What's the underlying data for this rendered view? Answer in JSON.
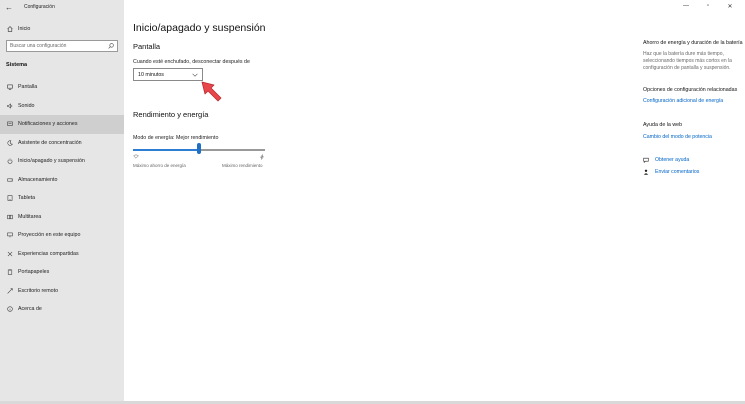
{
  "window": {
    "title": "Configuración"
  },
  "title_controls": {
    "back": "←",
    "minimize": "—",
    "maximize": "▫",
    "close": "✕"
  },
  "sidebar": {
    "home_label": "Inicio",
    "search_placeholder": "Buscar una configuración",
    "section": "Sistema",
    "items": [
      {
        "label": "Pantalla",
        "icon": "monitor-icon",
        "active": false
      },
      {
        "label": "Sonido",
        "icon": "speaker-icon",
        "active": false
      },
      {
        "label": "Notificaciones y acciones",
        "icon": "notifications-icon",
        "active": true
      },
      {
        "label": "Asistente de concentración",
        "icon": "moon-icon",
        "active": false
      },
      {
        "label": "Inicio/apagado y suspensión",
        "icon": "power-icon",
        "active": false
      },
      {
        "label": "Almacenamiento",
        "icon": "storage-icon",
        "active": false
      },
      {
        "label": "Tableta",
        "icon": "tablet-icon",
        "active": false
      },
      {
        "label": "Multitarea",
        "icon": "multitask-icon",
        "active": false
      },
      {
        "label": "Proyección en este equipo",
        "icon": "projection-icon",
        "active": false
      },
      {
        "label": "Experiencias compartidas",
        "icon": "shared-icon",
        "active": false
      },
      {
        "label": "Portapapeles",
        "icon": "clipboard-icon",
        "active": false
      },
      {
        "label": "Escritorio remoto",
        "icon": "remote-desktop-icon",
        "active": false
      },
      {
        "label": "Acerca de",
        "icon": "info-icon",
        "active": false
      }
    ]
  },
  "main": {
    "title": "Inicio/apagado y suspensión",
    "screen_section": "Pantalla",
    "screen_field_label": "Cuando esté enchufado, desconectar después de",
    "screen_dropdown_value": "10 minutos",
    "performance_section": "Rendimiento y energía",
    "power_mode_label": "Modo de energía: Mejor rendimiento",
    "slider_level": 0.5,
    "slider_min_label": "Máximo ahorro de energía",
    "slider_max_label": "Máximo rendimiento"
  },
  "right_pane": {
    "battery_heading": "Ahorro de energía y duración de la batería",
    "battery_text": "Haz que la batería dure más tiempo, seleccionando tiempos más cortos en la configuración de pantalla y suspensión.",
    "related_heading": "Opciones de configuración relacionadas",
    "related_link": "Configuración adicional de energía",
    "web_help_heading": "Ayuda de la web",
    "web_help_link": "Cambio del modo de potencia",
    "get_help": "Obtener ayuda",
    "feedback": "Enviar comentarios"
  },
  "colors": {
    "accent": "#0064c8",
    "pointer": "#e8464a",
    "sidebar_bg": "#e6e6e6",
    "active_item": "#cfcfcf"
  }
}
